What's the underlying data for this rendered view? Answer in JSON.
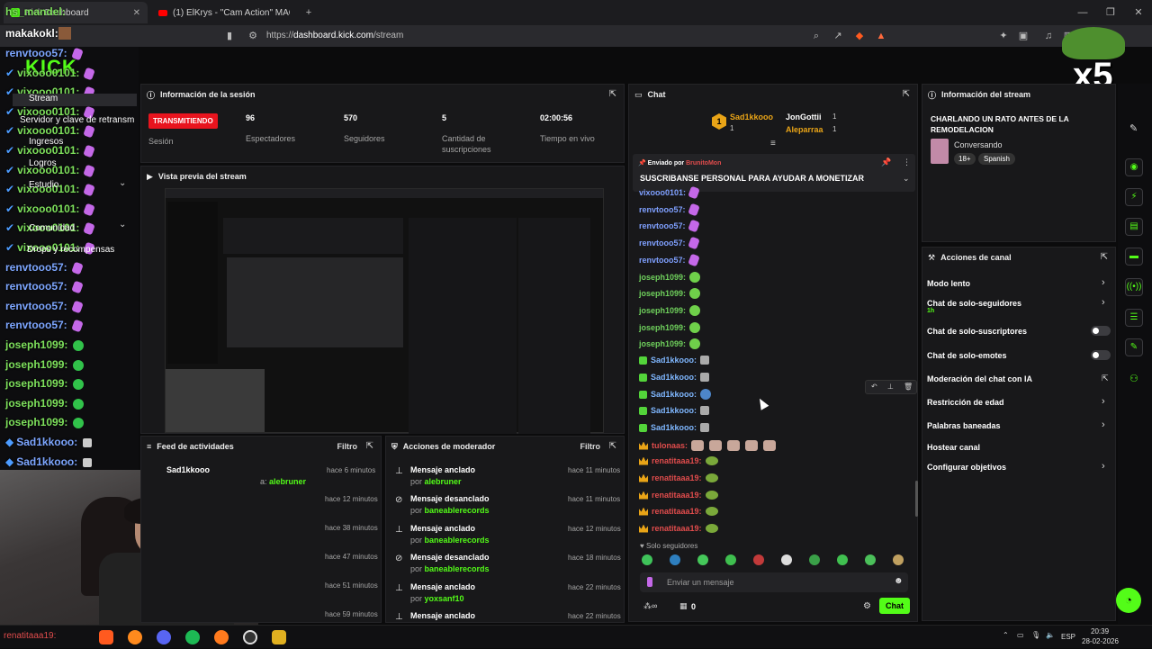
{
  "browser": {
    "tabs": [
      {
        "label": "Kick Dashboard",
        "active": true
      },
      {
        "label": "(1) ElKrys - \"Cam Action\" MAQUETA",
        "active": false
      }
    ],
    "new_tab": "+",
    "url_prefix": "https://",
    "url_host": "dashboard.kick.com",
    "url_path": "/stream"
  },
  "overlay_chat": {
    "header_names": [
      "hs_mandel:",
      "makakokl:"
    ],
    "messages": [
      {
        "user": "renvtooo57:",
        "color": "blue",
        "emote": "kick"
      },
      {
        "user": "vixooo0101:",
        "color": "green",
        "emote": "purple"
      },
      {
        "user": "vixooo0101:",
        "color": "green",
        "emote": "purple"
      },
      {
        "user": "vixooo0101:",
        "color": "green",
        "emote": "purple"
      },
      {
        "user": "vixooo0101:",
        "color": "green",
        "emote": "purple"
      },
      {
        "user": "vixooo0101:",
        "color": "green",
        "emote": "purple"
      },
      {
        "user": "vixooo0101:",
        "color": "green",
        "emote": "purple"
      },
      {
        "user": "vixooo0101:",
        "color": "green",
        "emote": "purple"
      },
      {
        "user": "vixooo0101:",
        "color": "green",
        "emote": "purple"
      },
      {
        "user": "vixooo0101:",
        "color": "green",
        "emote": "purple"
      },
      {
        "user": "vixooo0101:",
        "color": "green",
        "emote": "purple"
      },
      {
        "user": "renvtooo57:",
        "color": "blue",
        "emote": "purple"
      },
      {
        "user": "renvtooo57:",
        "color": "blue",
        "emote": "purple"
      },
      {
        "user": "renvtooo57:",
        "color": "blue",
        "emote": "purple"
      },
      {
        "user": "renvtooo57:",
        "color": "blue",
        "emote": "purple"
      },
      {
        "user": "joseph1099:",
        "color": "green",
        "emote": "green"
      },
      {
        "user": "joseph1099:",
        "color": "green",
        "emote": "green"
      },
      {
        "user": "joseph1099:",
        "color": "green",
        "emote": "green"
      },
      {
        "user": "joseph1099:",
        "color": "green",
        "emote": "green"
      },
      {
        "user": "joseph1099:",
        "color": "green",
        "emote": "green"
      },
      {
        "user": "Sad1kkooo:",
        "color": "blue",
        "emote": "mic"
      },
      {
        "user": "Sad1kkooo:",
        "color": "blue",
        "emote": "mic"
      }
    ],
    "bottom_names": [
      "renatitaaa19:",
      "renatitaaa19:"
    ]
  },
  "left_nav": {
    "items": [
      "Stream",
      "Servidor y clave de retransm",
      "Ingresos",
      "Logros",
      "Estudio",
      "Comunidad",
      "Drops y recompensas"
    ]
  },
  "session_info": {
    "title": "Información de la sesión",
    "status_badge": "TRANSMITIENDO",
    "status_label": "Sesión",
    "stats": [
      {
        "value": "96",
        "label": "Espectadores"
      },
      {
        "value": "570",
        "label": "Seguidores"
      },
      {
        "value": "5",
        "label": "Cantidad de suscripciones"
      },
      {
        "value": "02:00:56",
        "label": "Tiempo en vivo"
      }
    ]
  },
  "preview": {
    "title": "Vista previa del stream"
  },
  "activity_feed": {
    "title": "Feed de actividades",
    "filter": "Filtro",
    "rows": [
      {
        "user": "Sad1kkooo",
        "sub_prefix": "a:",
        "sub_user": "alebruner",
        "time": "hace 6 minutos"
      },
      {
        "time": "hace 12 minutos"
      },
      {
        "time": "hace 38 minutos"
      },
      {
        "time": "hace 47 minutos"
      },
      {
        "time": "hace 51 minutos"
      },
      {
        "time": "hace 59 minutos"
      }
    ]
  },
  "mod_actions": {
    "title": "Acciones de moderador",
    "filter": "Filtro",
    "rows": [
      {
        "action": "Mensaje anclado",
        "by": "por",
        "user": "alebruner",
        "time": "hace 11 minutos",
        "icon": "pin"
      },
      {
        "action": "Mensaje desanclado",
        "by": "por",
        "user": "baneablerecords",
        "time": "hace 11 minutos",
        "icon": "unpin"
      },
      {
        "action": "Mensaje anclado",
        "by": "por",
        "user": "baneablerecords",
        "time": "hace 12 minutos",
        "icon": "pin"
      },
      {
        "action": "Mensaje desanclado",
        "by": "por",
        "user": "baneablerecords",
        "time": "hace 18 minutos",
        "icon": "unpin"
      },
      {
        "action": "Mensaje anclado",
        "by": "por",
        "user": "yoxsanf10",
        "time": "hace 22 minutos",
        "icon": "pin"
      },
      {
        "action": "Mensaje anclado",
        "by": "",
        "user": "",
        "time": "hace 22 minutos",
        "icon": "pin"
      }
    ]
  },
  "chat": {
    "title": "Chat",
    "leaders": [
      {
        "rank": "1",
        "name": "Sad1kkooo",
        "count": "1"
      },
      {
        "name": "JonGottii",
        "count": "1"
      },
      {
        "name": "Aleparraa",
        "count": "1"
      }
    ],
    "pinned": {
      "sent_by_label": "Enviado por",
      "sent_by_user": "BrunitoMon",
      "text": "SUSCRIBANSE PERSONAL PARA AYUDAR A MONETIZAR"
    },
    "messages": [
      {
        "user": "vixooo0101:",
        "color": "blue",
        "emote": "purple",
        "badge": ""
      },
      {
        "user": "renvtooo57:",
        "color": "blue",
        "emote": "purple",
        "badge": ""
      },
      {
        "user": "renvtooo57:",
        "color": "blue",
        "emote": "purple",
        "badge": ""
      },
      {
        "user": "renvtooo57:",
        "color": "blue",
        "emote": "purple",
        "badge": ""
      },
      {
        "user": "renvtooo57:",
        "color": "blue",
        "emote": "purple",
        "badge": ""
      },
      {
        "user": "joseph1099:",
        "color": "green",
        "emote": "green",
        "badge": ""
      },
      {
        "user": "joseph1099:",
        "color": "green",
        "emote": "green",
        "badge": ""
      },
      {
        "user": "joseph1099:",
        "color": "green",
        "emote": "green",
        "badge": ""
      },
      {
        "user": "joseph1099:",
        "color": "green",
        "emote": "green",
        "badge": ""
      },
      {
        "user": "joseph1099:",
        "color": "green",
        "emote": "green",
        "badge": ""
      },
      {
        "user": "Sad1kkooo:",
        "color": "cyan",
        "emote": "mic",
        "badge": "green"
      },
      {
        "user": "Sad1kkooo:",
        "color": "cyan",
        "emote": "mic",
        "badge": "green"
      },
      {
        "user": "Sad1kkooo:",
        "color": "cyan",
        "emote": "globe",
        "badge": "green"
      },
      {
        "user": "Sad1kkooo:",
        "color": "cyan",
        "emote": "mic",
        "badge": "green"
      },
      {
        "user": "Sad1kkooo:",
        "color": "cyan",
        "emote": "mic",
        "badge": "green"
      },
      {
        "user": "tulonaas:",
        "color": "red",
        "emote": "faces",
        "badge": "crown"
      },
      {
        "user": "renatitaaa19:",
        "color": "red",
        "emote": "frog",
        "badge": "crown"
      },
      {
        "user": "renatitaaa19:",
        "color": "red",
        "emote": "frog",
        "badge": "crown"
      },
      {
        "user": "renatitaaa19:",
        "color": "red",
        "emote": "frog",
        "badge": "crown"
      },
      {
        "user": "renatitaaa19:",
        "color": "red",
        "emote": "frog",
        "badge": "crown"
      },
      {
        "user": "renatitaaa19:",
        "color": "red",
        "emote": "frog",
        "badge": "crown"
      }
    ],
    "followers_only": "Solo seguidores",
    "input_placeholder": "Enviar un mensaje",
    "points": "0",
    "send_label": "Chat"
  },
  "stream_info": {
    "title": "Información del stream",
    "stream_title": "CHARLANDO UN RATO ANTES DE LA REMODELACION",
    "category": "Conversando",
    "tags": [
      "18+",
      "Spanish"
    ]
  },
  "channel_actions": {
    "title": "Acciones de canal",
    "items": [
      {
        "label": "Modo lento",
        "control": "chevron",
        "sub": ""
      },
      {
        "label": "Chat de solo-seguidores",
        "control": "chevron",
        "sub": "1h"
      },
      {
        "label": "Chat de solo-suscriptores",
        "control": "toggle",
        "sub": ""
      },
      {
        "label": "Chat de solo-emotes",
        "control": "toggle",
        "sub": ""
      },
      {
        "label": "Moderación del chat con IA",
        "control": "external",
        "sub": ""
      },
      {
        "label": "Restricción de edad",
        "control": "chevron",
        "sub": ""
      },
      {
        "label": "Palabras baneadas",
        "control": "chevron",
        "sub": ""
      },
      {
        "label": "Hostear canal",
        "control": "none",
        "sub": ""
      },
      {
        "label": "Configurar objetivos",
        "control": "chevron",
        "sub": ""
      }
    ]
  },
  "overlay_badge": "x5",
  "taskbar": {
    "lang": "ESP",
    "time": "20:39",
    "date": "28-02-2026"
  },
  "colors": {
    "accent": "#53fc18",
    "live": "#e8141e",
    "panel": "#18181a"
  }
}
